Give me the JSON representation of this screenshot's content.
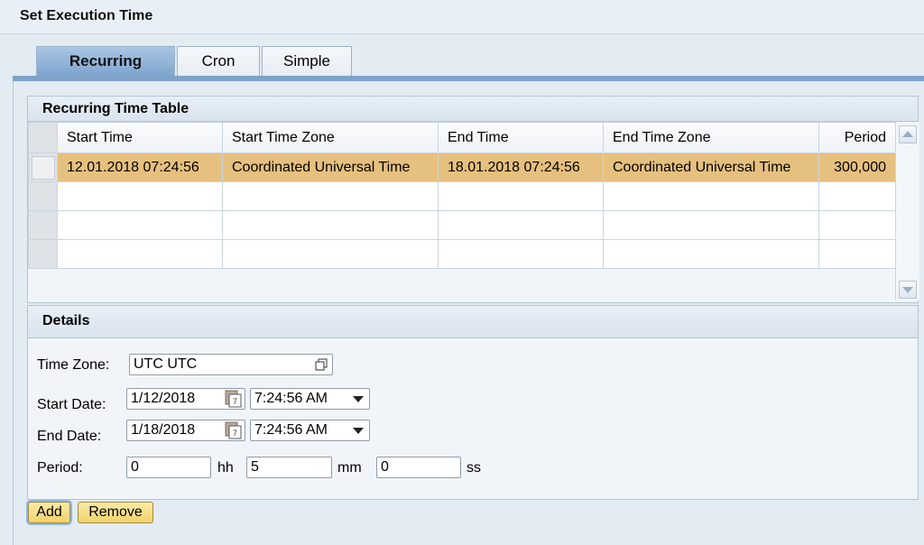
{
  "window": {
    "title": "Set Execution Time"
  },
  "tabs": [
    {
      "label": "Recurring",
      "active": true
    },
    {
      "label": "Cron",
      "active": false
    },
    {
      "label": "Simple",
      "active": false
    }
  ],
  "recurring_table": {
    "title": "Recurring Time Table",
    "columns": [
      "Start Time",
      "Start Time Zone",
      "End Time",
      "End Time Zone",
      "Period"
    ],
    "rows": [
      {
        "start_time": "12.01.2018 07:24:56",
        "start_zone": "Coordinated Universal Time",
        "end_time": "18.01.2018 07:24:56",
        "end_zone": "Coordinated Universal Time",
        "period": "300,000"
      }
    ]
  },
  "details": {
    "title": "Details",
    "time_zone_label": "Time Zone:",
    "time_zone_value": "UTC UTC",
    "start_date_label": "Start Date:",
    "start_date_value": "1/12/2018",
    "start_time_value": "7:24:56 AM",
    "end_date_label": "End Date:",
    "end_date_value": "1/18/2018",
    "end_time_value": "7:24:56 AM",
    "period_label": "Period:",
    "hh_value": "0",
    "hh_unit": "hh",
    "mm_value": "5",
    "mm_unit": "mm",
    "ss_value": "0",
    "ss_unit": "ss"
  },
  "actions": {
    "add_label": "Add",
    "remove_label": "Remove"
  },
  "colors": {
    "selected_row": "#e6c07e",
    "active_tab": "#8fb1d6",
    "button_yellow": "#f5dc80"
  }
}
